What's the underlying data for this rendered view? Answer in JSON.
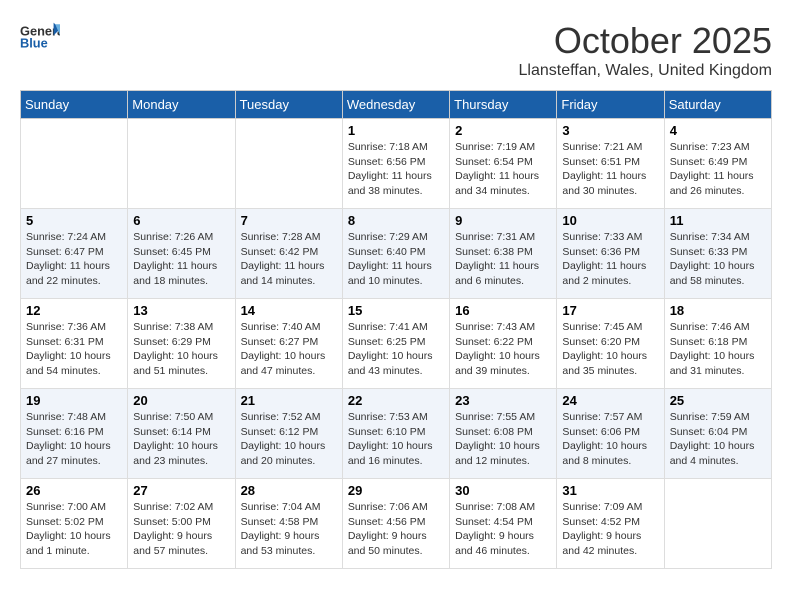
{
  "header": {
    "logo_general": "General",
    "logo_blue": "Blue",
    "month": "October 2025",
    "location": "Llansteffan, Wales, United Kingdom"
  },
  "weekdays": [
    "Sunday",
    "Monday",
    "Tuesday",
    "Wednesday",
    "Thursday",
    "Friday",
    "Saturday"
  ],
  "weeks": [
    [
      {
        "day": "",
        "sunrise": "",
        "sunset": "",
        "daylight": ""
      },
      {
        "day": "",
        "sunrise": "",
        "sunset": "",
        "daylight": ""
      },
      {
        "day": "",
        "sunrise": "",
        "sunset": "",
        "daylight": ""
      },
      {
        "day": "1",
        "sunrise": "Sunrise: 7:18 AM",
        "sunset": "Sunset: 6:56 PM",
        "daylight": "Daylight: 11 hours and 38 minutes."
      },
      {
        "day": "2",
        "sunrise": "Sunrise: 7:19 AM",
        "sunset": "Sunset: 6:54 PM",
        "daylight": "Daylight: 11 hours and 34 minutes."
      },
      {
        "day": "3",
        "sunrise": "Sunrise: 7:21 AM",
        "sunset": "Sunset: 6:51 PM",
        "daylight": "Daylight: 11 hours and 30 minutes."
      },
      {
        "day": "4",
        "sunrise": "Sunrise: 7:23 AM",
        "sunset": "Sunset: 6:49 PM",
        "daylight": "Daylight: 11 hours and 26 minutes."
      }
    ],
    [
      {
        "day": "5",
        "sunrise": "Sunrise: 7:24 AM",
        "sunset": "Sunset: 6:47 PM",
        "daylight": "Daylight: 11 hours and 22 minutes."
      },
      {
        "day": "6",
        "sunrise": "Sunrise: 7:26 AM",
        "sunset": "Sunset: 6:45 PM",
        "daylight": "Daylight: 11 hours and 18 minutes."
      },
      {
        "day": "7",
        "sunrise": "Sunrise: 7:28 AM",
        "sunset": "Sunset: 6:42 PM",
        "daylight": "Daylight: 11 hours and 14 minutes."
      },
      {
        "day": "8",
        "sunrise": "Sunrise: 7:29 AM",
        "sunset": "Sunset: 6:40 PM",
        "daylight": "Daylight: 11 hours and 10 minutes."
      },
      {
        "day": "9",
        "sunrise": "Sunrise: 7:31 AM",
        "sunset": "Sunset: 6:38 PM",
        "daylight": "Daylight: 11 hours and 6 minutes."
      },
      {
        "day": "10",
        "sunrise": "Sunrise: 7:33 AM",
        "sunset": "Sunset: 6:36 PM",
        "daylight": "Daylight: 11 hours and 2 minutes."
      },
      {
        "day": "11",
        "sunrise": "Sunrise: 7:34 AM",
        "sunset": "Sunset: 6:33 PM",
        "daylight": "Daylight: 10 hours and 58 minutes."
      }
    ],
    [
      {
        "day": "12",
        "sunrise": "Sunrise: 7:36 AM",
        "sunset": "Sunset: 6:31 PM",
        "daylight": "Daylight: 10 hours and 54 minutes."
      },
      {
        "day": "13",
        "sunrise": "Sunrise: 7:38 AM",
        "sunset": "Sunset: 6:29 PM",
        "daylight": "Daylight: 10 hours and 51 minutes."
      },
      {
        "day": "14",
        "sunrise": "Sunrise: 7:40 AM",
        "sunset": "Sunset: 6:27 PM",
        "daylight": "Daylight: 10 hours and 47 minutes."
      },
      {
        "day": "15",
        "sunrise": "Sunrise: 7:41 AM",
        "sunset": "Sunset: 6:25 PM",
        "daylight": "Daylight: 10 hours and 43 minutes."
      },
      {
        "day": "16",
        "sunrise": "Sunrise: 7:43 AM",
        "sunset": "Sunset: 6:22 PM",
        "daylight": "Daylight: 10 hours and 39 minutes."
      },
      {
        "day": "17",
        "sunrise": "Sunrise: 7:45 AM",
        "sunset": "Sunset: 6:20 PM",
        "daylight": "Daylight: 10 hours and 35 minutes."
      },
      {
        "day": "18",
        "sunrise": "Sunrise: 7:46 AM",
        "sunset": "Sunset: 6:18 PM",
        "daylight": "Daylight: 10 hours and 31 minutes."
      }
    ],
    [
      {
        "day": "19",
        "sunrise": "Sunrise: 7:48 AM",
        "sunset": "Sunset: 6:16 PM",
        "daylight": "Daylight: 10 hours and 27 minutes."
      },
      {
        "day": "20",
        "sunrise": "Sunrise: 7:50 AM",
        "sunset": "Sunset: 6:14 PM",
        "daylight": "Daylight: 10 hours and 23 minutes."
      },
      {
        "day": "21",
        "sunrise": "Sunrise: 7:52 AM",
        "sunset": "Sunset: 6:12 PM",
        "daylight": "Daylight: 10 hours and 20 minutes."
      },
      {
        "day": "22",
        "sunrise": "Sunrise: 7:53 AM",
        "sunset": "Sunset: 6:10 PM",
        "daylight": "Daylight: 10 hours and 16 minutes."
      },
      {
        "day": "23",
        "sunrise": "Sunrise: 7:55 AM",
        "sunset": "Sunset: 6:08 PM",
        "daylight": "Daylight: 10 hours and 12 minutes."
      },
      {
        "day": "24",
        "sunrise": "Sunrise: 7:57 AM",
        "sunset": "Sunset: 6:06 PM",
        "daylight": "Daylight: 10 hours and 8 minutes."
      },
      {
        "day": "25",
        "sunrise": "Sunrise: 7:59 AM",
        "sunset": "Sunset: 6:04 PM",
        "daylight": "Daylight: 10 hours and 4 minutes."
      }
    ],
    [
      {
        "day": "26",
        "sunrise": "Sunrise: 7:00 AM",
        "sunset": "Sunset: 5:02 PM",
        "daylight": "Daylight: 10 hours and 1 minute."
      },
      {
        "day": "27",
        "sunrise": "Sunrise: 7:02 AM",
        "sunset": "Sunset: 5:00 PM",
        "daylight": "Daylight: 9 hours and 57 minutes."
      },
      {
        "day": "28",
        "sunrise": "Sunrise: 7:04 AM",
        "sunset": "Sunset: 4:58 PM",
        "daylight": "Daylight: 9 hours and 53 minutes."
      },
      {
        "day": "29",
        "sunrise": "Sunrise: 7:06 AM",
        "sunset": "Sunset: 4:56 PM",
        "daylight": "Daylight: 9 hours and 50 minutes."
      },
      {
        "day": "30",
        "sunrise": "Sunrise: 7:08 AM",
        "sunset": "Sunset: 4:54 PM",
        "daylight": "Daylight: 9 hours and 46 minutes."
      },
      {
        "day": "31",
        "sunrise": "Sunrise: 7:09 AM",
        "sunset": "Sunset: 4:52 PM",
        "daylight": "Daylight: 9 hours and 42 minutes."
      },
      {
        "day": "",
        "sunrise": "",
        "sunset": "",
        "daylight": ""
      }
    ]
  ]
}
